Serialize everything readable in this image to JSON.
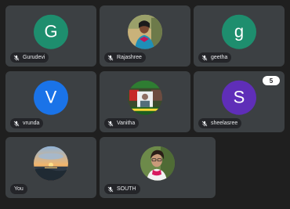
{
  "participants": [
    {
      "name": "Gurudevi",
      "initial": "G",
      "avatar_color": "#1e8e6e",
      "muted": true,
      "avatar_kind": "initial"
    },
    {
      "name": "Rajashree",
      "initial": "",
      "avatar_color": "",
      "muted": true,
      "avatar_kind": "photo"
    },
    {
      "name": "geetha",
      "initial": "g",
      "avatar_color": "#1e8e6e",
      "muted": true,
      "avatar_kind": "initial"
    },
    {
      "name": "vrunda",
      "initial": "V",
      "avatar_color": "#1a73e8",
      "muted": true,
      "avatar_kind": "initial"
    },
    {
      "name": "Vanitha",
      "initial": "",
      "avatar_color": "",
      "muted": true,
      "avatar_kind": "photo"
    },
    {
      "name": "sheelasree",
      "initial": "S",
      "avatar_color": "#5f2eb8",
      "muted": true,
      "avatar_kind": "initial"
    },
    {
      "name": "You",
      "initial": "",
      "avatar_color": "",
      "muted": false,
      "avatar_kind": "photo"
    },
    {
      "name": "SOUTH",
      "initial": "",
      "avatar_color": "",
      "muted": true,
      "avatar_kind": "photo"
    }
  ],
  "hidden_participants_count": "5",
  "icons": {
    "mic": "mic-off-icon"
  }
}
